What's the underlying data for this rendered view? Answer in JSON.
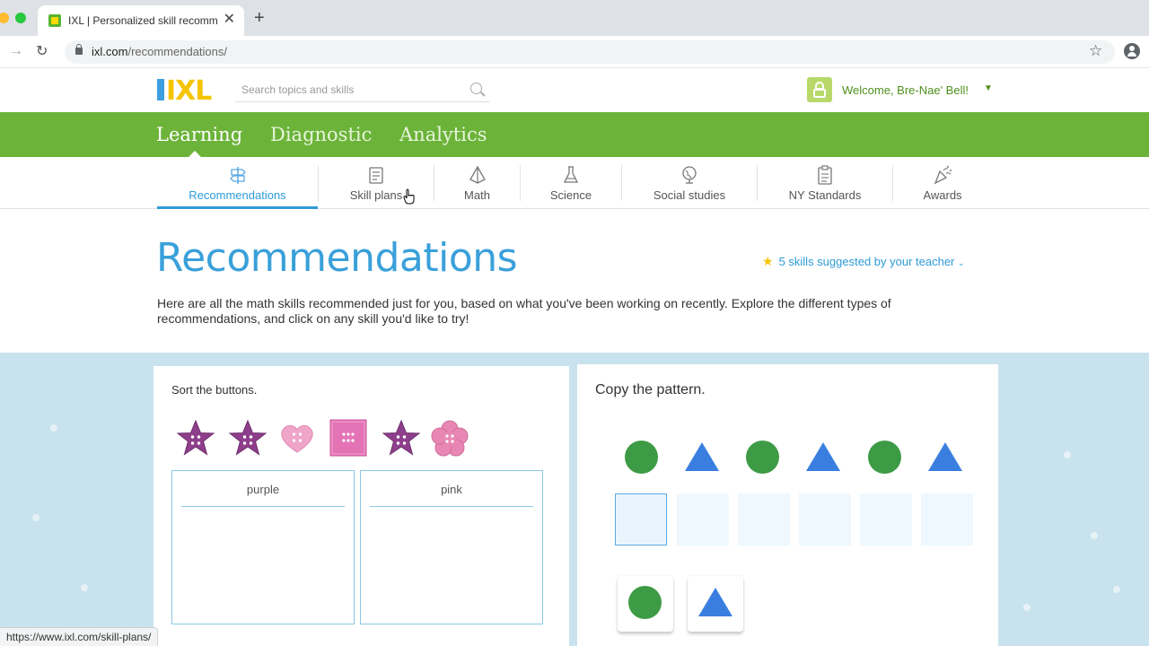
{
  "browser": {
    "tab_title": "IXL | Personalized skill recomm",
    "tab_close": "✕",
    "new_tab": "+",
    "url_host": "ixl.com",
    "url_path": "/recommendations/",
    "status_url": "https://www.ixl.com/skill-plans/"
  },
  "header": {
    "logo_text": "IXL",
    "search_placeholder": "Search topics and skills",
    "welcome": "Welcome, Bre-Nae' Bell!",
    "caret": "▼"
  },
  "main_nav": {
    "items": [
      {
        "label": "Learning"
      },
      {
        "label": "Diagnostic"
      },
      {
        "label": "Analytics"
      }
    ]
  },
  "sub_nav": {
    "items": [
      {
        "label": "Recommendations",
        "icon": "signpost-icon"
      },
      {
        "label": "Skill plans",
        "icon": "skill-plan-icon"
      },
      {
        "label": "Math",
        "icon": "pyramid-icon"
      },
      {
        "label": "Science",
        "icon": "flask-icon"
      },
      {
        "label": "Social studies",
        "icon": "globe-icon"
      },
      {
        "label": "NY Standards",
        "icon": "clipboard-icon"
      },
      {
        "label": "Awards",
        "icon": "party-popper-icon"
      }
    ]
  },
  "page": {
    "title": "Recommendations",
    "teacher_star": "★",
    "teacher_link": "5 skills suggested by your teacher",
    "teacher_caret": "⌄",
    "description": "Here are all the math skills recommended just for you, based on what you've been working on recently. Explore the different types of recommendations, and click on any skill you'd like to try!"
  },
  "card_sort": {
    "prompt": "Sort the buttons.",
    "box_labels": [
      "purple",
      "pink"
    ],
    "buttons": [
      "purple-star-button",
      "purple-star-button",
      "pink-heart-button",
      "pink-square-button",
      "purple-star-button",
      "pink-flower-button"
    ]
  },
  "card_pattern": {
    "prompt": "Copy the pattern.",
    "pattern": [
      "green-circle",
      "blue-triangle",
      "green-circle",
      "blue-triangle",
      "green-circle",
      "blue-triangle"
    ],
    "answer_slots": 6,
    "tiles": [
      "green-circle",
      "blue-triangle"
    ]
  },
  "colors": {
    "brand_green": "#6cb33a",
    "brand_blue": "#3aa0da",
    "shape_green": "#3e9b45",
    "shape_blue": "#3a7fe0"
  }
}
